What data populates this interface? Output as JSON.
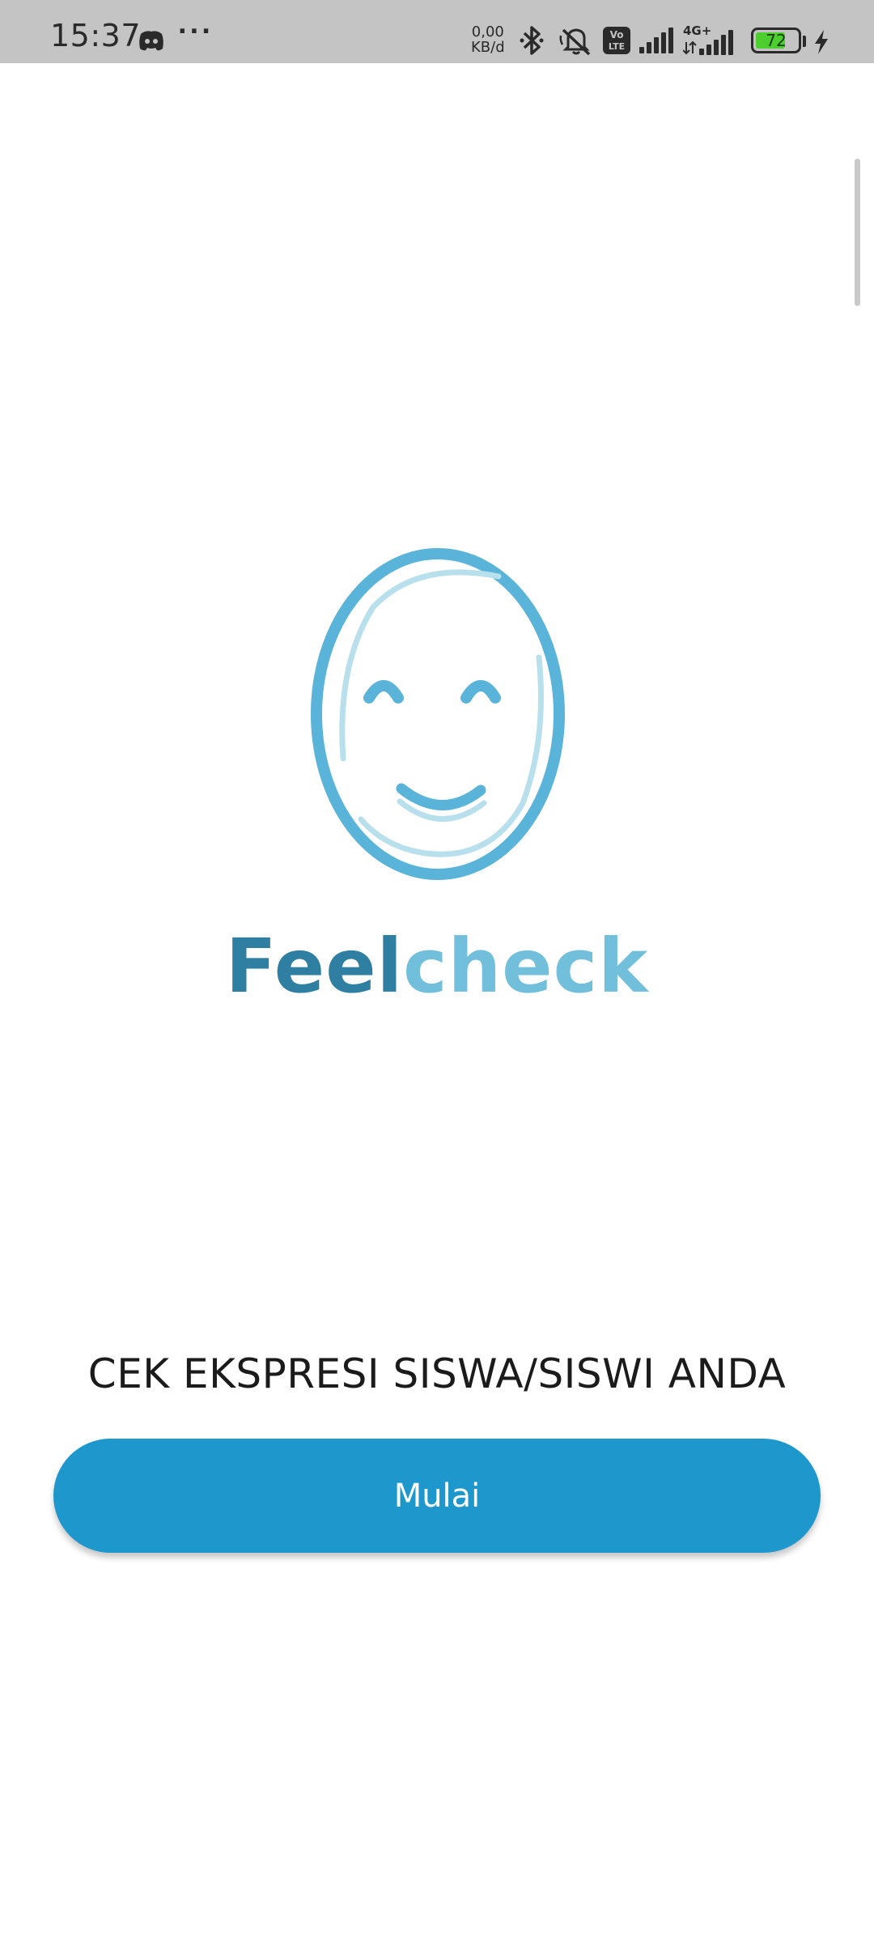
{
  "status_bar": {
    "time": "15:37",
    "more_label": "···",
    "speed_value": "0,00",
    "speed_unit": "KB/d",
    "volte_label": "Vo LTE",
    "network_label": "4G+",
    "battery": {
      "label": "72",
      "level": 0.72,
      "fill_color": "#4cce2e"
    },
    "icons": [
      "discord-icon",
      "bluetooth-icon",
      "mute-icon",
      "volte-icon",
      "signal-icon",
      "signal-4g-icon",
      "battery-icon",
      "charging-icon"
    ]
  },
  "logo": {
    "brand_part1": "Feel",
    "brand_part2": "check",
    "colors": {
      "dark": "#2e7fa2",
      "light": "#72bfdc",
      "face_outline": "#5ab3d8",
      "face_inner": "#b8e0ec"
    }
  },
  "main": {
    "tagline": "CEK EKSPRESI SISWA/SISWI ANDA",
    "start_button_label": "Mulai",
    "button_color": "#1e98cc"
  }
}
